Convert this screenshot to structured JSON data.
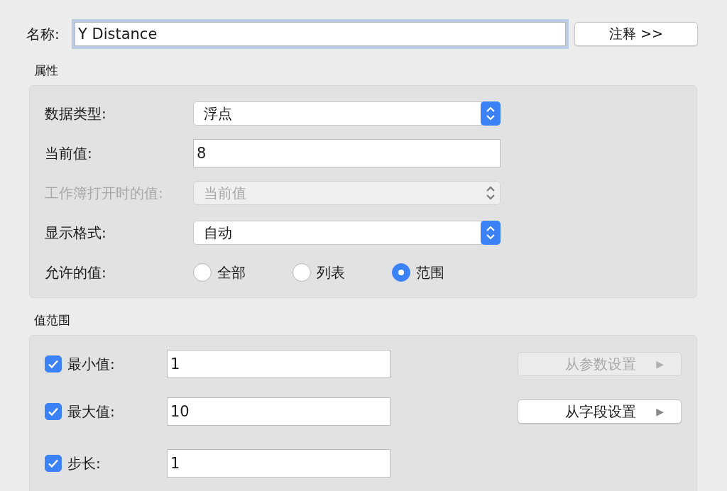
{
  "name_field": {
    "label": "名称:",
    "value": "Y Distance",
    "focused": true
  },
  "comment_button": {
    "label": "注释 >>"
  },
  "properties": {
    "title": "属性",
    "rows": [
      {
        "kind": "select",
        "label": "数据类型:",
        "value": "浮点",
        "disabled": false
      },
      {
        "kind": "text",
        "label": "当前值:",
        "value": "8"
      },
      {
        "kind": "select",
        "label": "工作簿打开时的值:",
        "value": "当前值",
        "disabled": true
      },
      {
        "kind": "select",
        "label": "显示格式:",
        "value": "自动",
        "disabled": false
      },
      {
        "kind": "radio",
        "label": "允许的值:",
        "options": [
          {
            "label": "全部",
            "selected": false
          },
          {
            "label": "列表",
            "selected": false
          },
          {
            "label": "范围",
            "selected": true
          }
        ]
      }
    ]
  },
  "value_range": {
    "title": "值范围",
    "rows": [
      {
        "label": "最小值:",
        "checked": true,
        "value": "1",
        "button": {
          "label": "从参数设置",
          "arrow": "▶",
          "disabled": true
        }
      },
      {
        "label": "最大值:",
        "checked": true,
        "value": "10",
        "button": {
          "label": "从字段设置",
          "arrow": "▶",
          "disabled": false
        }
      },
      {
        "label": "步长:",
        "checked": true,
        "value": "1"
      }
    ]
  }
}
